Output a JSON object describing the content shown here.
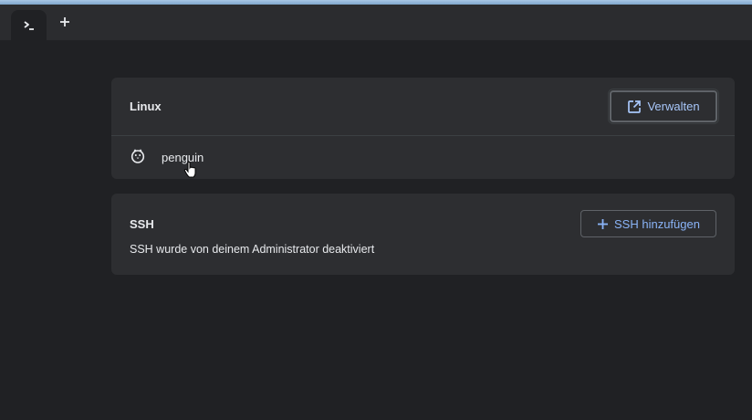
{
  "tabs": [
    {
      "icon": "terminal-prompt-icon",
      "label": ">_"
    }
  ],
  "new_tab": {
    "icon": "plus-icon"
  },
  "linux_section": {
    "title": "Linux",
    "manage_button": {
      "label": "Verwalten",
      "icon": "open-in-new-icon"
    },
    "containers": [
      {
        "name": "penguin",
        "icon": "penguin-icon"
      }
    ]
  },
  "ssh_section": {
    "title": "SSH",
    "add_button": {
      "label": "SSH hinzufügen",
      "icon": "plus-icon"
    },
    "description": "SSH wurde von deinem Administrator deaktiviert"
  },
  "colors": {
    "background": "#202124",
    "card": "#2d2e31",
    "accent": "#8ab4f8",
    "text": "#e8eaed"
  }
}
